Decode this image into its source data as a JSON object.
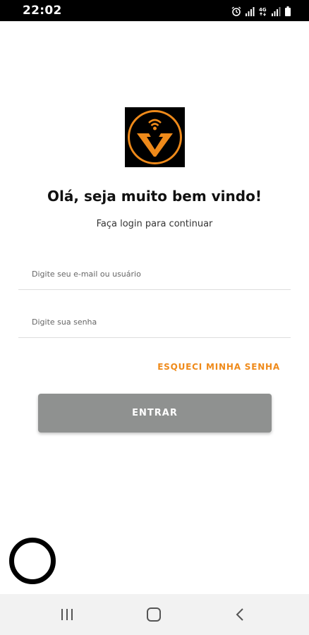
{
  "status_bar": {
    "time": "22:02",
    "icons": [
      "alarm-icon",
      "signal-icon",
      "4g-icon",
      "signal-icon",
      "battery-icon"
    ]
  },
  "logo": {
    "icon": "pin-v-logo",
    "accent_color": "#ef8a1a"
  },
  "header": {
    "title": "Olá, seja muito bem vindo!",
    "subtitle": "Faça login para continuar"
  },
  "form": {
    "email_placeholder": "Digite seu e-mail ou usuário",
    "email_value": "",
    "password_placeholder": "Digite sua senha",
    "password_value": "",
    "forgot_label": "ESQUECI MINHA SENHA",
    "submit_label": "ENTRAR"
  },
  "colors": {
    "accent": "#ef8a1a",
    "button_disabled": "#8f9190",
    "status_bar": "#000000",
    "nav_bar": "#f2f2f2"
  },
  "navigation": {
    "buttons": [
      "recent-apps-icon",
      "home-icon",
      "back-icon"
    ]
  }
}
